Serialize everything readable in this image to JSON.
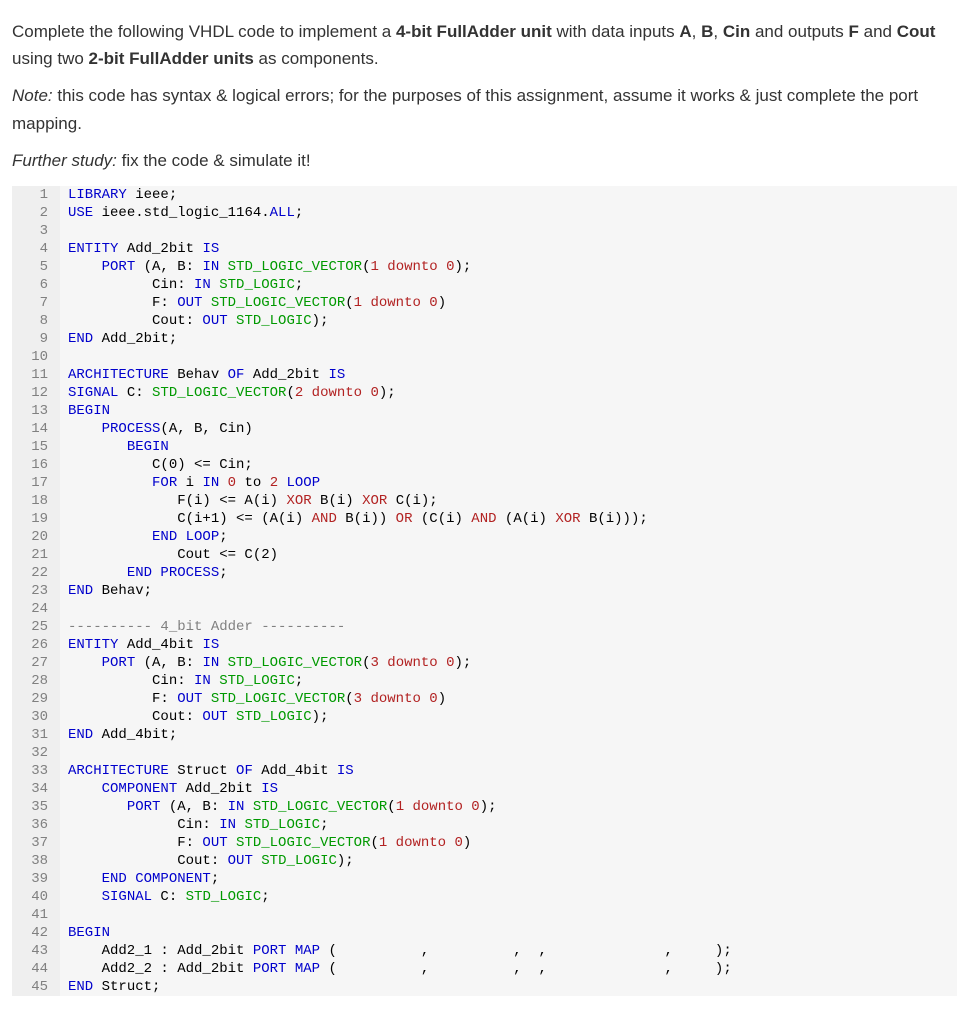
{
  "prompt": {
    "p1_a": "Complete the following VHDL code to implement a ",
    "p1_b": "4-bit FullAdder unit",
    "p1_c": " with data inputs ",
    "p1_d": "A",
    "p1_e": ", ",
    "p1_f": "B",
    "p1_g": ", ",
    "p1_h": "Cin",
    "p1_i": " and outputs ",
    "p1_j": "F",
    "p1_k": " and ",
    "p1_l": "Cout",
    "p1_m": " using two ",
    "p1_n": "2-bit FullAdder units",
    "p1_o": " as components.",
    "note_label": "Note:",
    "note_text": " this code has syntax & logical errors; for the purposes of this assignment, assume it works & just complete the port mapping.",
    "study_label": "Further study:",
    "study_text": " fix the code & simulate it!"
  },
  "code": [
    {
      "n": "1",
      "tokens": [
        [
          "kw",
          "LIBRARY"
        ],
        [
          "ident",
          " ieee;"
        ]
      ]
    },
    {
      "n": "2",
      "tokens": [
        [
          "kw",
          "USE"
        ],
        [
          "ident",
          " ieee.std_logic_1164."
        ],
        [
          "kw",
          "ALL"
        ],
        [
          "punct",
          ";"
        ]
      ]
    },
    {
      "n": "3",
      "tokens": []
    },
    {
      "n": "4",
      "tokens": [
        [
          "kw",
          "ENTITY"
        ],
        [
          "ident",
          " Add_2bit "
        ],
        [
          "kw",
          "IS"
        ]
      ]
    },
    {
      "n": "5",
      "tokens": [
        [
          "ident",
          "    "
        ],
        [
          "kw",
          "PORT"
        ],
        [
          "ident",
          " (A, B: "
        ],
        [
          "kw",
          "IN"
        ],
        [
          "ident",
          " "
        ],
        [
          "type",
          "STD_LOGIC_VECTOR"
        ],
        [
          "punct",
          "("
        ],
        [
          "num",
          "1 downto 0"
        ],
        [
          "punct",
          ");"
        ]
      ]
    },
    {
      "n": "6",
      "tokens": [
        [
          "ident",
          "          Cin: "
        ],
        [
          "kw",
          "IN"
        ],
        [
          "ident",
          " "
        ],
        [
          "type",
          "STD_LOGIC"
        ],
        [
          "punct",
          ";"
        ]
      ]
    },
    {
      "n": "7",
      "tokens": [
        [
          "ident",
          "          F: "
        ],
        [
          "kw",
          "OUT"
        ],
        [
          "ident",
          " "
        ],
        [
          "type",
          "STD_LOGIC_VECTOR"
        ],
        [
          "punct",
          "("
        ],
        [
          "num",
          "1 downto 0"
        ],
        [
          "punct",
          ")"
        ]
      ]
    },
    {
      "n": "8",
      "tokens": [
        [
          "ident",
          "          Cout: "
        ],
        [
          "kw",
          "OUT"
        ],
        [
          "ident",
          " "
        ],
        [
          "type",
          "STD_LOGIC"
        ],
        [
          "punct",
          ");"
        ]
      ]
    },
    {
      "n": "9",
      "tokens": [
        [
          "kw",
          "END"
        ],
        [
          "ident",
          " Add_2bit;"
        ]
      ]
    },
    {
      "n": "10",
      "tokens": []
    },
    {
      "n": "11",
      "tokens": [
        [
          "kw",
          "ARCHITECTURE"
        ],
        [
          "ident",
          " Behav "
        ],
        [
          "kw",
          "OF"
        ],
        [
          "ident",
          " Add_2bit "
        ],
        [
          "kw",
          "IS"
        ]
      ]
    },
    {
      "n": "12",
      "tokens": [
        [
          "kw",
          "SIGNAL"
        ],
        [
          "ident",
          " C: "
        ],
        [
          "type",
          "STD_LOGIC_VECTOR"
        ],
        [
          "punct",
          "("
        ],
        [
          "num",
          "2 downto 0"
        ],
        [
          "punct",
          ");"
        ]
      ]
    },
    {
      "n": "13",
      "tokens": [
        [
          "kw",
          "BEGIN"
        ]
      ]
    },
    {
      "n": "14",
      "tokens": [
        [
          "ident",
          "    "
        ],
        [
          "kw",
          "PROCESS"
        ],
        [
          "ident",
          "(A, B, Cin)"
        ]
      ]
    },
    {
      "n": "15",
      "tokens": [
        [
          "ident",
          "       "
        ],
        [
          "kw",
          "BEGIN"
        ]
      ]
    },
    {
      "n": "16",
      "tokens": [
        [
          "ident",
          "          C(0) <= Cin;"
        ]
      ]
    },
    {
      "n": "17",
      "tokens": [
        [
          "ident",
          "          "
        ],
        [
          "kw",
          "FOR"
        ],
        [
          "ident",
          " i "
        ],
        [
          "kw",
          "IN"
        ],
        [
          "ident",
          " "
        ],
        [
          "num",
          "0"
        ],
        [
          "ident",
          " to "
        ],
        [
          "num",
          "2"
        ],
        [
          "ident",
          " "
        ],
        [
          "kw",
          "LOOP"
        ]
      ]
    },
    {
      "n": "18",
      "tokens": [
        [
          "ident",
          "             F(i) <= A(i) "
        ],
        [
          "op",
          "XOR"
        ],
        [
          "ident",
          " B(i) "
        ],
        [
          "op",
          "XOR"
        ],
        [
          "ident",
          " C(i);"
        ]
      ]
    },
    {
      "n": "19",
      "tokens": [
        [
          "ident",
          "             C(i+1) <= (A(i) "
        ],
        [
          "op",
          "AND"
        ],
        [
          "ident",
          " B(i)) "
        ],
        [
          "op",
          "OR"
        ],
        [
          "ident",
          " (C(i) "
        ],
        [
          "op",
          "AND"
        ],
        [
          "ident",
          " (A(i) "
        ],
        [
          "op",
          "XOR"
        ],
        [
          "ident",
          " B(i)));"
        ]
      ]
    },
    {
      "n": "20",
      "tokens": [
        [
          "ident",
          "          "
        ],
        [
          "kw",
          "END LOOP"
        ],
        [
          "punct",
          ";"
        ]
      ]
    },
    {
      "n": "21",
      "tokens": [
        [
          "ident",
          "             Cout <= C(2)"
        ]
      ]
    },
    {
      "n": "22",
      "tokens": [
        [
          "ident",
          "       "
        ],
        [
          "kw",
          "END PROCESS"
        ],
        [
          "punct",
          ";"
        ]
      ]
    },
    {
      "n": "23",
      "tokens": [
        [
          "kw",
          "END"
        ],
        [
          "ident",
          " Behav;"
        ]
      ]
    },
    {
      "n": "24",
      "tokens": []
    },
    {
      "n": "25",
      "tokens": [
        [
          "cmt",
          "---------- 4_bit Adder ----------"
        ]
      ]
    },
    {
      "n": "26",
      "tokens": [
        [
          "kw",
          "ENTITY"
        ],
        [
          "ident",
          " Add_4bit "
        ],
        [
          "kw",
          "IS"
        ]
      ]
    },
    {
      "n": "27",
      "tokens": [
        [
          "ident",
          "    "
        ],
        [
          "kw",
          "PORT"
        ],
        [
          "ident",
          " (A, B: "
        ],
        [
          "kw",
          "IN"
        ],
        [
          "ident",
          " "
        ],
        [
          "type",
          "STD_LOGIC_VECTOR"
        ],
        [
          "punct",
          "("
        ],
        [
          "num",
          "3 downto 0"
        ],
        [
          "punct",
          ");"
        ]
      ]
    },
    {
      "n": "28",
      "tokens": [
        [
          "ident",
          "          Cin: "
        ],
        [
          "kw",
          "IN"
        ],
        [
          "ident",
          " "
        ],
        [
          "type",
          "STD_LOGIC"
        ],
        [
          "punct",
          ";"
        ]
      ]
    },
    {
      "n": "29",
      "tokens": [
        [
          "ident",
          "          F: "
        ],
        [
          "kw",
          "OUT"
        ],
        [
          "ident",
          " "
        ],
        [
          "type",
          "STD_LOGIC_VECTOR"
        ],
        [
          "punct",
          "("
        ],
        [
          "num",
          "3 downto 0"
        ],
        [
          "punct",
          ")"
        ]
      ]
    },
    {
      "n": "30",
      "tokens": [
        [
          "ident",
          "          Cout: "
        ],
        [
          "kw",
          "OUT"
        ],
        [
          "ident",
          " "
        ],
        [
          "type",
          "STD_LOGIC"
        ],
        [
          "punct",
          ");"
        ]
      ]
    },
    {
      "n": "31",
      "tokens": [
        [
          "kw",
          "END"
        ],
        [
          "ident",
          " Add_4bit;"
        ]
      ]
    },
    {
      "n": "32",
      "tokens": []
    },
    {
      "n": "33",
      "tokens": [
        [
          "kw",
          "ARCHITECTURE"
        ],
        [
          "ident",
          " Struct "
        ],
        [
          "kw",
          "OF"
        ],
        [
          "ident",
          " Add_4bit "
        ],
        [
          "kw",
          "IS"
        ]
      ]
    },
    {
      "n": "34",
      "tokens": [
        [
          "ident",
          "    "
        ],
        [
          "kw",
          "COMPONENT"
        ],
        [
          "ident",
          " Add_2bit "
        ],
        [
          "kw",
          "IS"
        ]
      ]
    },
    {
      "n": "35",
      "tokens": [
        [
          "ident",
          "       "
        ],
        [
          "kw",
          "PORT"
        ],
        [
          "ident",
          " (A, B: "
        ],
        [
          "kw",
          "IN"
        ],
        [
          "ident",
          " "
        ],
        [
          "type",
          "STD_LOGIC_VECTOR"
        ],
        [
          "punct",
          "("
        ],
        [
          "num",
          "1 downto 0"
        ],
        [
          "punct",
          ");"
        ]
      ]
    },
    {
      "n": "36",
      "tokens": [
        [
          "ident",
          "             Cin: "
        ],
        [
          "kw",
          "IN"
        ],
        [
          "ident",
          " "
        ],
        [
          "type",
          "STD_LOGIC"
        ],
        [
          "punct",
          ";"
        ]
      ]
    },
    {
      "n": "37",
      "tokens": [
        [
          "ident",
          "             F: "
        ],
        [
          "kw",
          "OUT"
        ],
        [
          "ident",
          " "
        ],
        [
          "type",
          "STD_LOGIC_VECTOR"
        ],
        [
          "punct",
          "("
        ],
        [
          "num",
          "1 downto 0"
        ],
        [
          "punct",
          ")"
        ]
      ]
    },
    {
      "n": "38",
      "tokens": [
        [
          "ident",
          "             Cout: "
        ],
        [
          "kw",
          "OUT"
        ],
        [
          "ident",
          " "
        ],
        [
          "type",
          "STD_LOGIC"
        ],
        [
          "punct",
          ");"
        ]
      ]
    },
    {
      "n": "39",
      "tokens": [
        [
          "ident",
          "    "
        ],
        [
          "kw",
          "END COMPONENT"
        ],
        [
          "punct",
          ";"
        ]
      ]
    },
    {
      "n": "40",
      "tokens": [
        [
          "ident",
          "    "
        ],
        [
          "kw",
          "SIGNAL"
        ],
        [
          "ident",
          " C: "
        ],
        [
          "type",
          "STD_LOGIC"
        ],
        [
          "punct",
          ";"
        ]
      ]
    },
    {
      "n": "41",
      "tokens": []
    },
    {
      "n": "42",
      "tokens": [
        [
          "kw",
          "BEGIN"
        ]
      ]
    },
    {
      "n": "43",
      "tokens": [
        [
          "ident",
          "    Add2_1 : Add_2bit "
        ],
        [
          "kw",
          "PORT MAP"
        ],
        [
          "ident",
          " (          ,          ,  ,              ,     );"
        ]
      ]
    },
    {
      "n": "44",
      "tokens": [
        [
          "ident",
          "    Add2_2 : Add_2bit "
        ],
        [
          "kw",
          "PORT MAP"
        ],
        [
          "ident",
          " (          ,          ,  ,              ,     );"
        ]
      ]
    },
    {
      "n": "45",
      "tokens": [
        [
          "kw",
          "END"
        ],
        [
          "ident",
          " Struct;"
        ]
      ]
    }
  ]
}
